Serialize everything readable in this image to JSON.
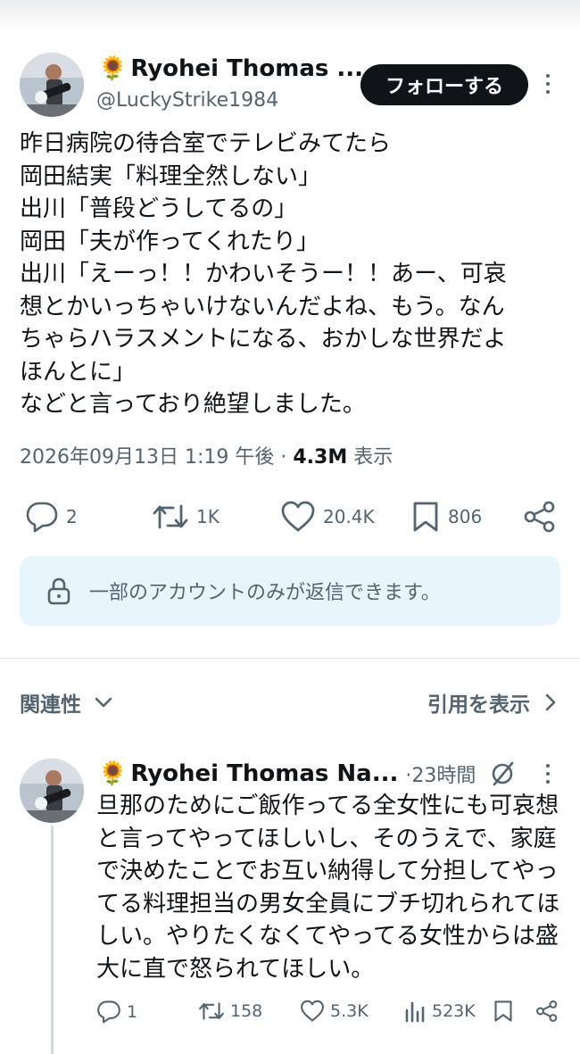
{
  "tweet": {
    "display_name": "Ryohei Thomas ...",
    "name_emoji": "🌻",
    "handle": "@LuckyStrike1984",
    "follow_label": "フォローする",
    "text_lines": [
      "昨日病院の待合室でテレビみてたら",
      "岡田結実「料理全然しない」",
      "出川「普段どうしてるの」",
      "岡田「夫が作ってくれたり」",
      "出川「えーっ！！かわいそうー！！あー、可哀",
      "想とかいっちゃいけないんだよね、もう。なん",
      "ちゃらハラスメントになる、おかしな世界だよ",
      "ほんとに」",
      "などと言っており絶望しました。"
    ],
    "timestamp": "2026年09月13日 1:19 午後",
    "separator": "·",
    "views_count": "4.3M",
    "views_label": "表示",
    "replies": "2",
    "retweets": "1K",
    "likes": "20.4K",
    "bookmarks": "806",
    "reply_restriction": "一部のアカウントのみが返信できます。"
  },
  "section": {
    "sort_label": "関連性",
    "view_quotes_label": "引用を表示"
  },
  "reply": {
    "display_name": "Ryohei Thomas Na...",
    "name_emoji": "🌻",
    "time": "·23時間",
    "text_lines": [
      "旦那のためにご飯作ってる全女性にも可哀想",
      "と言ってやってほしいし、そのうえで、家庭",
      "で決めたことでお互い納得して分担してやっ",
      "てる料理担当の男女全員にブチ切れられてほ",
      "しい。やりたくなくてやってる女性からは盛",
      "大に直で怒られてほしい。"
    ],
    "replies": "1",
    "retweets": "158",
    "likes": "5.3K",
    "views": "523K"
  },
  "colors": {
    "text": "#0f1419",
    "secondary": "#536471",
    "follow_bg": "#0f1419",
    "reply_box_bg": "#e8f5fd"
  },
  "icons": [
    "reply-icon",
    "retweet-icon",
    "like-icon",
    "bookmark-icon",
    "share-icon",
    "lock-icon",
    "chevron-down-icon",
    "chevron-right-icon",
    "grok-icon",
    "views-icon",
    "more-icon"
  ]
}
